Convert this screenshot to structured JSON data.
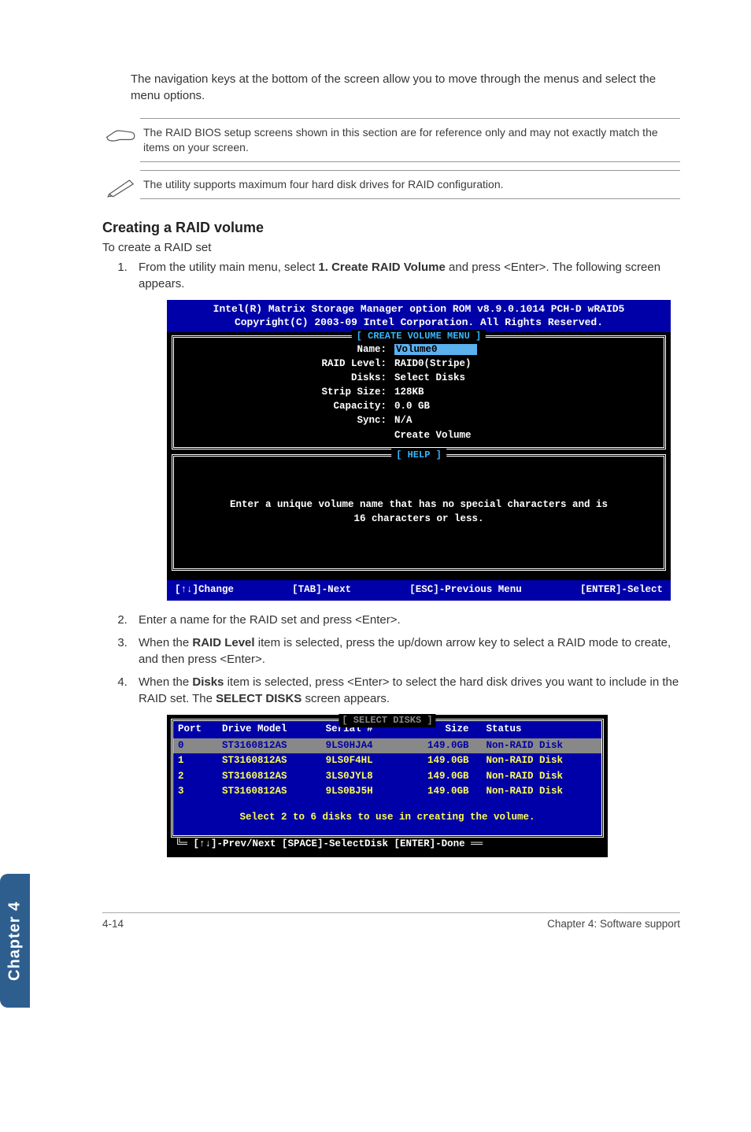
{
  "intro_text": "The navigation keys at the bottom of the screen allow you to move through the menus and select the menu options.",
  "notes": [
    "The RAID BIOS setup screens shown in this section are for reference only and may not exactly match the items on your screen.",
    "The utility supports maximum four hard disk drives for RAID configuration."
  ],
  "section_title": "Creating a RAID volume",
  "sub_intro": "To create a RAID set",
  "step1_prefix": "From the utility main menu, select ",
  "step1_bold": "1. Create RAID Volume",
  "step1_suffix": " and press <Enter>. The following screen appears.",
  "bios1": {
    "header1": "Intel(R) Matrix Storage Manager option ROM v8.9.0.1014 PCH-D wRAID5",
    "header2": "Copyright(C) 2003-09 Intel Corporation.  All Rights Reserved.",
    "frame1_title": "[ CREATE VOLUME MENU ]",
    "fields": {
      "name_label": "Name:",
      "name_value": "Volume0",
      "raid_level_label": "RAID Level:",
      "raid_level_value": "RAID0(Stripe)",
      "disks_label": "Disks:",
      "disks_value": "Select Disks",
      "strip_size_label": "Strip Size:",
      "strip_size_value": "128KB",
      "capacity_label": "Capacity:",
      "capacity_value": "0.0   GB",
      "sync_label": "Sync:",
      "sync_value": "N/A",
      "create_volume": "Create Volume"
    },
    "frame2_title": "[ HELP ]",
    "help_line1": "Enter a unique volume name that has no special characters and is",
    "help_line2": "16 characters or less.",
    "footer": {
      "change": "[↑↓]Change",
      "next": "[TAB]-Next",
      "prev": "[ESC]-Previous Menu",
      "select": "[ENTER]-Select"
    }
  },
  "step2": "Enter a name for the RAID set and press <Enter>.",
  "step3_prefix": "When the ",
  "step3_bold": "RAID Level",
  "step3_suffix": " item is selected, press the up/down arrow key to select a RAID mode to create, and then press <Enter>.",
  "step4_prefix": "When the ",
  "step4_bold1": "Disks",
  "step4_mid": " item is selected, press <Enter> to select the hard disk drives you want to include in the RAID set. The ",
  "step4_bold2": "SELECT DISKS",
  "step4_suffix": " screen appears.",
  "bios2": {
    "title": "[ SELECT DISKS ]",
    "columns": {
      "port": "Port",
      "model": "Drive Model",
      "serial": "Serial #",
      "size": "Size",
      "status": "Status"
    },
    "rows": [
      {
        "port": "0",
        "model": "ST3160812AS",
        "serial": "9LS0HJA4",
        "size": "149.0GB",
        "status": "Non-RAID Disk",
        "selected": true
      },
      {
        "port": "1",
        "model": "ST3160812AS",
        "serial": "9LS0F4HL",
        "size": "149.0GB",
        "status": "Non-RAID Disk",
        "selected": false
      },
      {
        "port": "2",
        "model": "ST3160812AS",
        "serial": "3LS0JYL8",
        "size": "149.0GB",
        "status": "Non-RAID Disk",
        "selected": false
      },
      {
        "port": "3",
        "model": "ST3160812AS",
        "serial": "9LS0BJ5H",
        "size": "149.0GB",
        "status": "Non-RAID Disk",
        "selected": false
      }
    ],
    "msg": "Select 2 to 6 disks to use in creating the volume.",
    "footer": "[↑↓]-Prev/Next [SPACE]-SelectDisk [ENTER]-Done"
  },
  "side_tab": "Chapter 4",
  "page_footer_left": "4-14",
  "page_footer_right": "Chapter 4: Software support"
}
